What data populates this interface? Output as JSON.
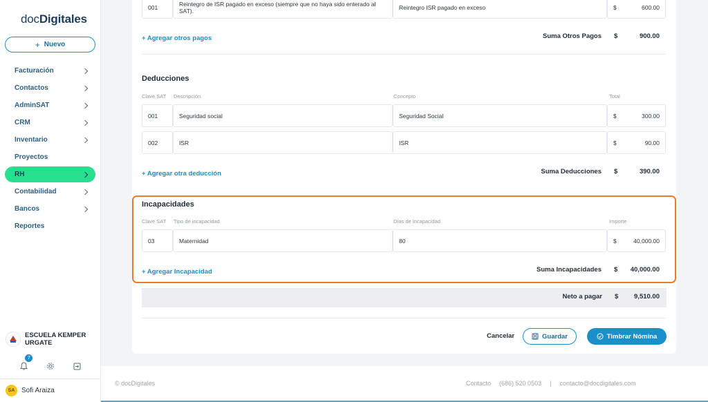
{
  "app": {
    "logo_prefix": "doc",
    "logo_suffix": "Digitales",
    "new_button": "Nuevo"
  },
  "sidebar": {
    "items": [
      {
        "label": "Facturación",
        "chevron": true,
        "active": false
      },
      {
        "label": "Contactos",
        "chevron": true,
        "active": false
      },
      {
        "label": "AdminSAT",
        "chevron": true,
        "active": false
      },
      {
        "label": "CRM",
        "chevron": true,
        "active": false
      },
      {
        "label": "Inventario",
        "chevron": true,
        "active": false
      },
      {
        "label": "Proyectos",
        "chevron": false,
        "active": false
      },
      {
        "label": "RH",
        "chevron": true,
        "active": true
      },
      {
        "label": "Contabilidad",
        "chevron": true,
        "active": false
      },
      {
        "label": "Bancos",
        "chevron": true,
        "active": false
      },
      {
        "label": "Reportes",
        "chevron": false,
        "active": false
      }
    ],
    "org_name": "ESCUELA KEMPER URGATE",
    "notifications_count": "7",
    "user_initials": "SA",
    "user_name": "Sofi Araiza"
  },
  "otros_pagos": {
    "row": {
      "clave": "001",
      "descripcion": "Reintegro de ISR pagado en exceso (siempre que no haya sido enterado al SAT).",
      "concepto": "Reintegro ISR pagado en exceso",
      "currency": "$",
      "total": "600.00"
    },
    "add_link": "+ Agregar otros pagos",
    "sum_label": "Suma Otros Pagos",
    "sum_currency": "$",
    "sum_value": "900.00"
  },
  "deducciones": {
    "title": "Deducciones",
    "headers": {
      "clave": "Clave SAT",
      "descripcion": "Descripción",
      "concepto": "Concepto",
      "total": "Total"
    },
    "rows": [
      {
        "clave": "001",
        "descripcion": "Seguridad social",
        "concepto": "Seguridad Social",
        "currency": "$",
        "total": "300.00"
      },
      {
        "clave": "002",
        "descripcion": "ISR",
        "concepto": "ISR",
        "currency": "$",
        "total": "90.00"
      }
    ],
    "add_link": "+ Agregar otra deducción",
    "sum_label": "Suma Deducciones",
    "sum_currency": "$",
    "sum_value": "390.00"
  },
  "incapacidades": {
    "title": "Incapacidades",
    "headers": {
      "clave": "Clave SAT",
      "tipo": "Tipo de incapacidad",
      "dias": "Días de incapacidad",
      "importe": "Importe"
    },
    "row": {
      "clave": "03",
      "tipo": "Maternidad",
      "dias": "80",
      "currency": "$",
      "importe": "40,000.00"
    },
    "add_link": "+ Agregar Incapacidad",
    "sum_label": "Suma Incapacidades",
    "sum_currency": "$",
    "sum_value": "40,000.00"
  },
  "neto": {
    "label": "Neto a pagar",
    "currency": "$",
    "value": "9,510.00"
  },
  "actions": {
    "cancel": "Cancelar",
    "save": "Guardar",
    "stamp": "Timbrar Nómina"
  },
  "footer": {
    "copyright": "© docDigitales",
    "contact_label": "Contacto",
    "phone": "(686) 520 0503",
    "separator": "|",
    "email": "contacto@docdigitales.com"
  },
  "colors": {
    "accent": "#1a8fc9",
    "active_nav": "#27e08f",
    "highlight": "#ec7a2c"
  }
}
